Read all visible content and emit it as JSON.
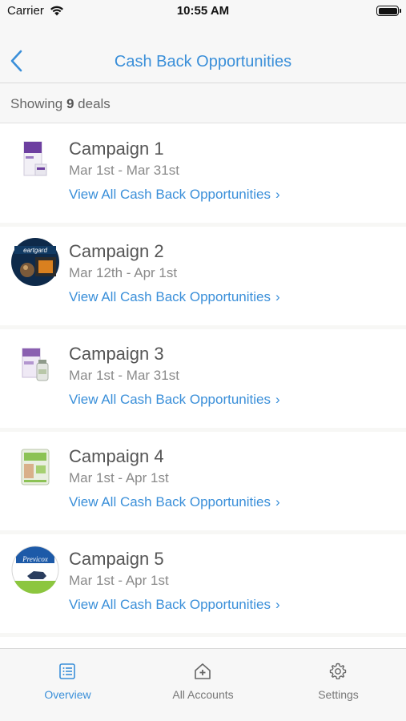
{
  "status_bar": {
    "carrier": "Carrier",
    "time": "10:55 AM"
  },
  "nav": {
    "title": "Cash Back Opportunities",
    "back_icon": "chevron-left-icon"
  },
  "summary": {
    "prefix": "Showing",
    "count": "9",
    "suffix": "deals"
  },
  "campaigns": [
    {
      "name": "Campaign 1",
      "dates": "Mar 1st - Mar 31st",
      "link": "View All Cash Back Opportunities"
    },
    {
      "name": "Campaign 2",
      "dates": "Mar 12th - Apr 1st",
      "link": "View All Cash Back Opportunities",
      "logo_text": "eartgard"
    },
    {
      "name": "Campaign 3",
      "dates": "Mar 1st - Mar 31st",
      "link": "View All Cash Back Opportunities"
    },
    {
      "name": "Campaign 4",
      "dates": "Mar 1st - Apr 1st",
      "link": "View All Cash Back Opportunities"
    },
    {
      "name": "Campaign 5",
      "dates": "Mar 1st - Apr 1st",
      "link": "View All Cash Back Opportunities",
      "logo_text": "Previcox"
    }
  ],
  "tabs": [
    {
      "label": "Overview",
      "icon": "list-icon",
      "active": true
    },
    {
      "label": "All Accounts",
      "icon": "house-plus-icon",
      "active": false
    },
    {
      "label": "Settings",
      "icon": "gear-icon",
      "active": false
    }
  ],
  "colors": {
    "accent": "#3a8fd9",
    "bar_background": "#f7f7f7",
    "text": "#555555"
  }
}
